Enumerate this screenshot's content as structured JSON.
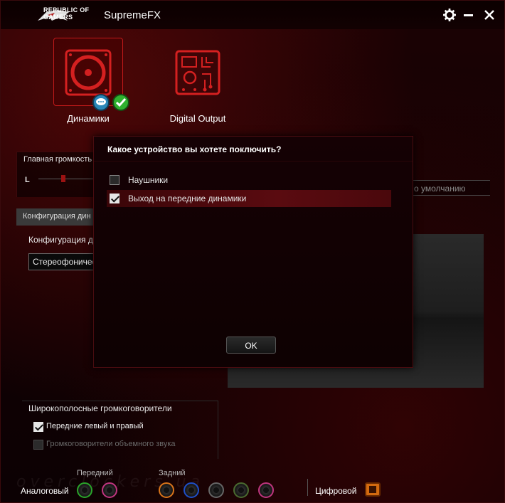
{
  "window": {
    "app_title": "SupremeFX",
    "brand_line1": "REPUBLIC OF",
    "brand_line2": "GAMERS"
  },
  "devices": [
    {
      "label": "Динамики",
      "selected": true,
      "icon": "speaker-icon"
    },
    {
      "label": "Digital Output",
      "selected": false,
      "icon": "circuit-board-icon"
    }
  ],
  "volume": {
    "title": "Главная громкость",
    "left_channel": "L"
  },
  "default_button": "о умолчанию",
  "config": {
    "tab_label": "Конфигурация дин",
    "field_label": "Конфигурация д",
    "select_value": "Стереофоничес"
  },
  "wideband": {
    "title": "Широкополосные громкоговорители",
    "options": [
      {
        "label": "Передние левый и правый",
        "checked": true,
        "enabled": true
      },
      {
        "label": "Громкоговорители объемного звука",
        "checked": false,
        "enabled": false
      }
    ]
  },
  "bottom": {
    "front_label": "Передний",
    "rear_label": "Задний",
    "analog_label": "Аналоговый",
    "digital_label": "Цифровой",
    "watermark": "overclockers.ua",
    "jack_colors": {
      "green": "#2aa52a",
      "pink": "#c0357f",
      "orange": "#d9741a",
      "blue": "#1e4fc7",
      "black": "#666666",
      "gray": "#4a6a30"
    }
  },
  "dialog": {
    "title": "Какое устройство вы хотете поключить?",
    "options": [
      {
        "label": "Наушники",
        "checked": false
      },
      {
        "label": "Выход на передние динамики",
        "checked": true
      }
    ],
    "ok_label": "OK"
  },
  "colors": {
    "accent_red": "#c21a1a",
    "selected_row": "#5a0b10"
  }
}
